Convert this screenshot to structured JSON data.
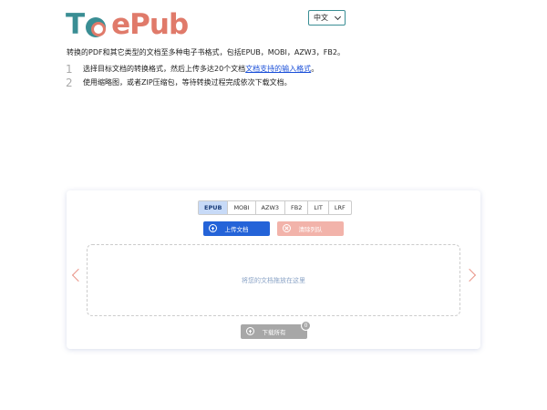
{
  "header": {
    "logo_text_1": "T",
    "logo_text_2": "ePub",
    "language": "中文"
  },
  "intro": {
    "description": "转换的PDF和其它类型的文档至多种电子书格式，包括EPUB，MOBI，AZW3，FB2。",
    "steps": [
      {
        "num": "1",
        "text": "选择目标文档的转换格式，然后上传多达20个文档",
        "link": "文档支持的输入格式",
        "tail": "。"
      },
      {
        "num": "2",
        "text": "使用缩略图，或者ZIP压缩包，等待转换过程完成依次下载文档。"
      }
    ]
  },
  "converter": {
    "tabs": [
      "EPUB",
      "MOBI",
      "AZW3",
      "FB2",
      "LIT",
      "LRF"
    ],
    "active_tab": "EPUB",
    "upload_label": "上传文档",
    "clear_label": "清除列队",
    "dropzone_text": "将您的文档拖放在这里",
    "download_label": "下载所有",
    "download_count": "0"
  },
  "colors": {
    "brand_teal": "#3a8e94",
    "brand_coral": "#e07a6a",
    "primary_blue": "#2463d8"
  }
}
